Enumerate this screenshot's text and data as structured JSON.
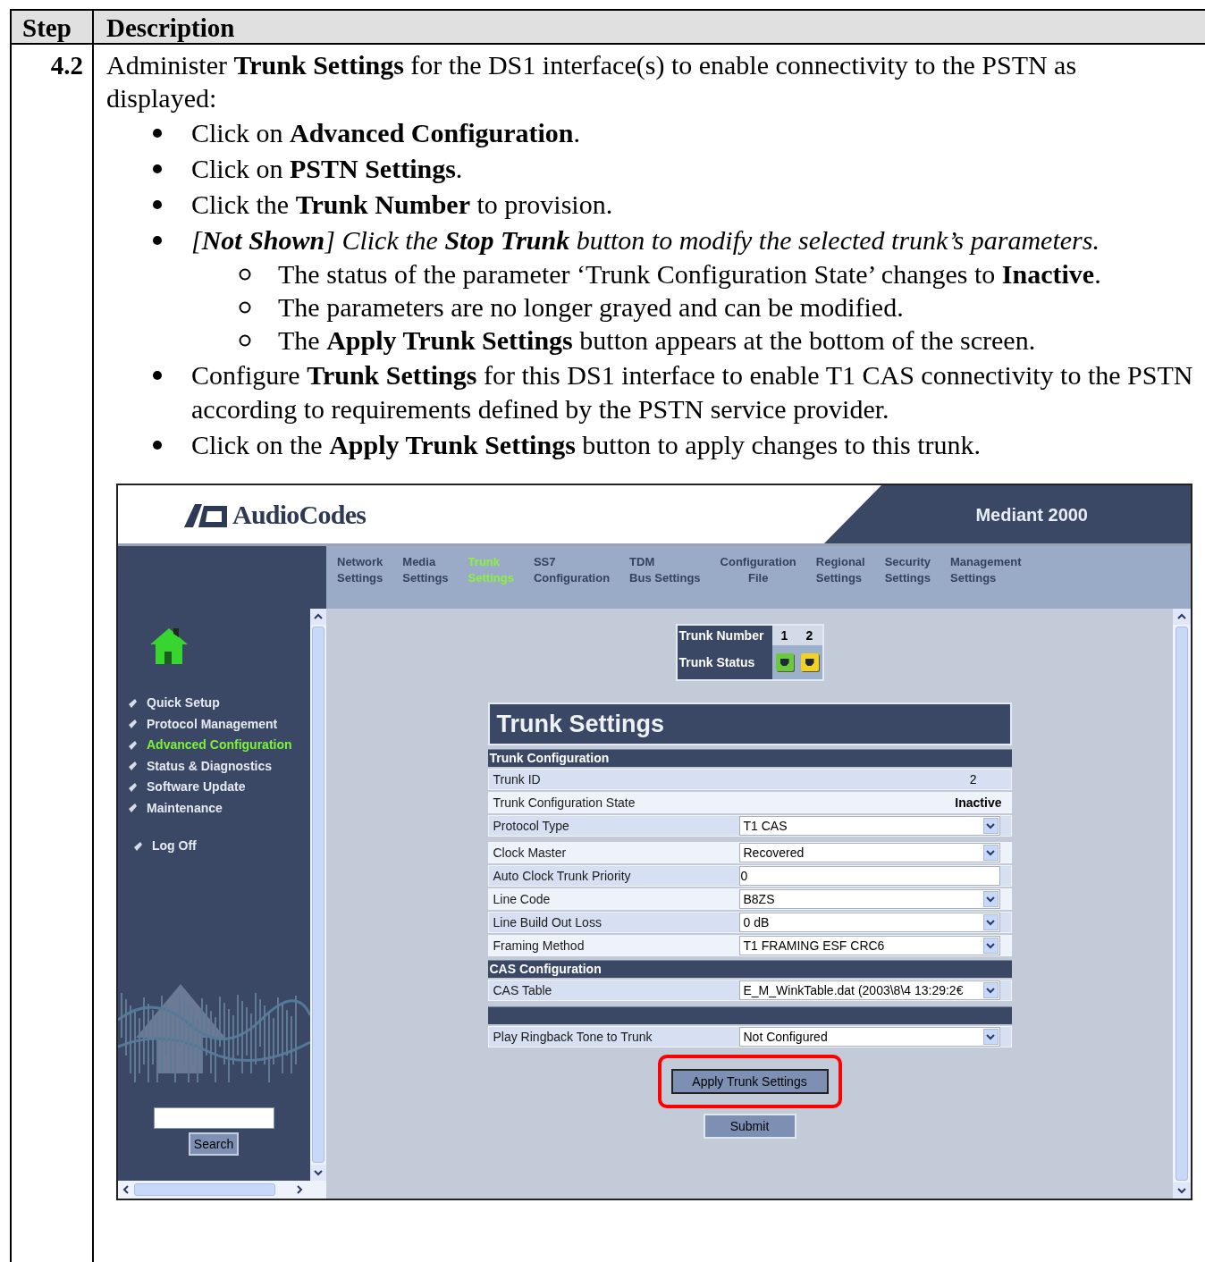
{
  "table": {
    "columns": [
      "Step",
      "Description"
    ],
    "rows": [
      {
        "step": "4.2",
        "intro": "Administer **Trunk Settings** for the DS1 interface(s) to enable connectivity to the PSTN as displayed:",
        "bullets": [
          {
            "text": "Click on **Advanced Configuration**.",
            "italic": false
          },
          {
            "text": "Click on **PSTN Settings**.",
            "italic": false
          },
          {
            "text": "Click the **Trunk Number** to provision.",
            "italic": false
          },
          {
            "text": "[**Not Shown**] Click the **Stop Trunk** button to modify the selected trunk’s parameters.",
            "italic": true,
            "children": [
              {
                "text": "The status of the parameter ‘Trunk Configuration State’ changes to **Inactive**."
              },
              {
                "text": "The parameters are no longer grayed and can be modified."
              },
              {
                "text": "The **Apply Trunk Settings** button appears at the bottom of the screen."
              }
            ]
          },
          {
            "text": "Configure **Trunk Settings** for this DS1 interface to enable T1 CAS connectivity to the PSTN according to requirements defined by the PSTN service provider.",
            "italic": false
          },
          {
            "text": "Click on the **Apply Trunk Settings** button to apply changes to this trunk.",
            "italic": false
          }
        ]
      }
    ]
  },
  "screenshot": {
    "header": {
      "logo": "AudioCodes",
      "product": "Mediant 2000"
    },
    "nav": [
      {
        "lines": [
          "Network",
          "Settings"
        ],
        "selected": false
      },
      {
        "lines": [
          "Media",
          "Settings"
        ],
        "selected": false
      },
      {
        "lines": [
          "Trunk",
          "Settings"
        ],
        "selected": true
      },
      {
        "lines": [
          "SS7",
          "Configuration"
        ],
        "selected": false
      },
      {
        "lines": [
          "TDM",
          "Bus Settings"
        ],
        "selected": false
      },
      {
        "lines": [
          "Configuration",
          "File"
        ],
        "selected": false
      },
      {
        "lines": [
          "Regional",
          "Settings"
        ],
        "selected": false
      },
      {
        "lines": [
          "Security",
          "Settings"
        ],
        "selected": false
      },
      {
        "lines": [
          "Management",
          "Settings"
        ],
        "selected": false
      }
    ],
    "sidebar": {
      "items": [
        {
          "label": "Quick Setup",
          "selected": false
        },
        {
          "label": "Protocol Management",
          "selected": false
        },
        {
          "label": "Advanced Configuration",
          "selected": true
        },
        {
          "label": "Status & Diagnostics",
          "selected": false
        },
        {
          "label": "Software Update",
          "selected": false
        },
        {
          "label": "Maintenance",
          "selected": false
        }
      ],
      "log_off": "Log Off",
      "search_button": "Search"
    },
    "trunk_selector": {
      "number_label": "Trunk Number",
      "status_label": "Trunk Status",
      "trunks": [
        {
          "number": "1",
          "color": "#6cc93a"
        },
        {
          "number": "2",
          "color": "#f2d21e"
        }
      ]
    },
    "panel": {
      "title": "Trunk Settings",
      "sections": [
        {
          "title": "Trunk Configuration",
          "rows": [
            {
              "label": "Trunk ID",
              "kind": "text",
              "value": "2"
            },
            {
              "label": "Trunk Configuration State",
              "kind": "status",
              "value": "Inactive"
            },
            {
              "label": "Protocol Type",
              "kind": "select",
              "value": "T1 CAS"
            },
            {
              "label": "Clock Master",
              "kind": "select",
              "value": "Recovered"
            },
            {
              "label": "Auto Clock Trunk Priority",
              "kind": "input",
              "value": "0"
            },
            {
              "label": "Line Code",
              "kind": "select",
              "value": "B8ZS"
            },
            {
              "label": "Line Build Out Loss",
              "kind": "select",
              "value": "0 dB"
            },
            {
              "label": "Framing Method",
              "kind": "select",
              "value": "T1 FRAMING ESF CRC6"
            }
          ]
        },
        {
          "title": "CAS Configuration",
          "rows": [
            {
              "label": "CAS Table",
              "kind": "select",
              "value": "E_M_WinkTable.dat (2003\\8\\4 13:29:2€"
            }
          ]
        },
        {
          "rows": [
            {
              "label": "Play Ringback Tone to Trunk",
              "kind": "select",
              "value": "Not Configured"
            }
          ]
        }
      ]
    },
    "buttons": [
      {
        "label": "Apply Trunk Settings",
        "highlighted": true
      },
      {
        "label": "Submit",
        "highlighted": false
      }
    ]
  }
}
